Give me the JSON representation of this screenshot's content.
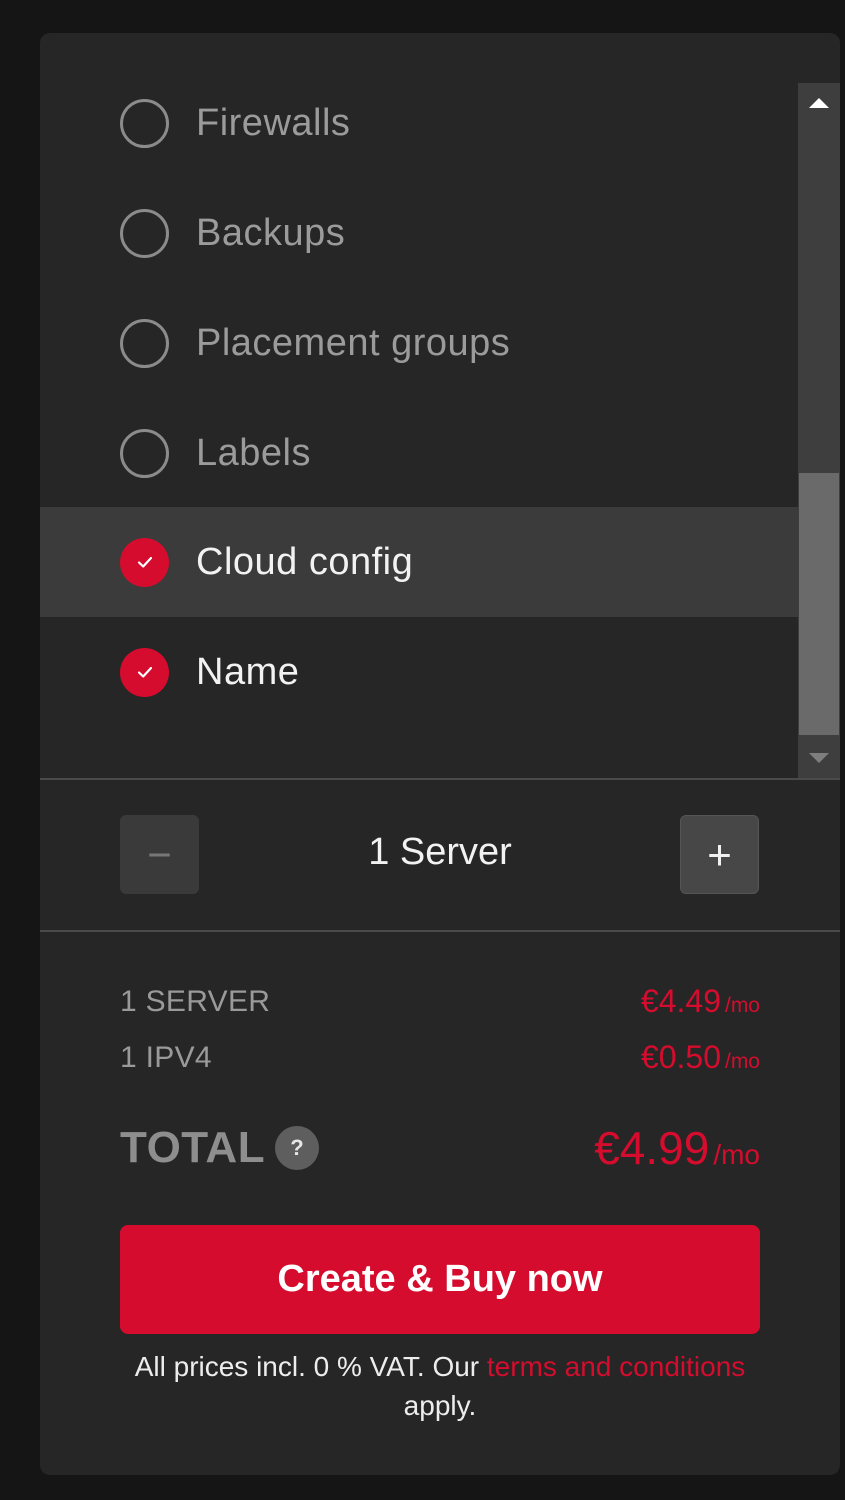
{
  "options": [
    {
      "label": "Firewalls",
      "checked": false
    },
    {
      "label": "Backups",
      "checked": false
    },
    {
      "label": "Placement groups",
      "checked": false
    },
    {
      "label": "Labels",
      "checked": false
    },
    {
      "label": "Cloud config",
      "checked": true,
      "highlighted": true
    },
    {
      "label": "Name",
      "checked": true
    }
  ],
  "stepper": {
    "count_label": "1 Server",
    "minus_symbol": "−",
    "plus_symbol": "+"
  },
  "pricing": {
    "rows": [
      {
        "label": "1 SERVER",
        "price": "€4.49",
        "unit": "/mo"
      },
      {
        "label": "1 IPV4",
        "price": "€0.50",
        "unit": "/mo"
      }
    ],
    "total_label": "TOTAL",
    "help_symbol": "?",
    "total_price": "€4.99",
    "total_unit": "/mo"
  },
  "buy_button_label": "Create & Buy now",
  "footer": {
    "prefix": "All prices incl. 0 % VAT. Our ",
    "link_text": "terms and conditions",
    "suffix": " apply."
  },
  "colors": {
    "accent": "#d50c2d",
    "panel": "#262626",
    "background": "#151515"
  }
}
